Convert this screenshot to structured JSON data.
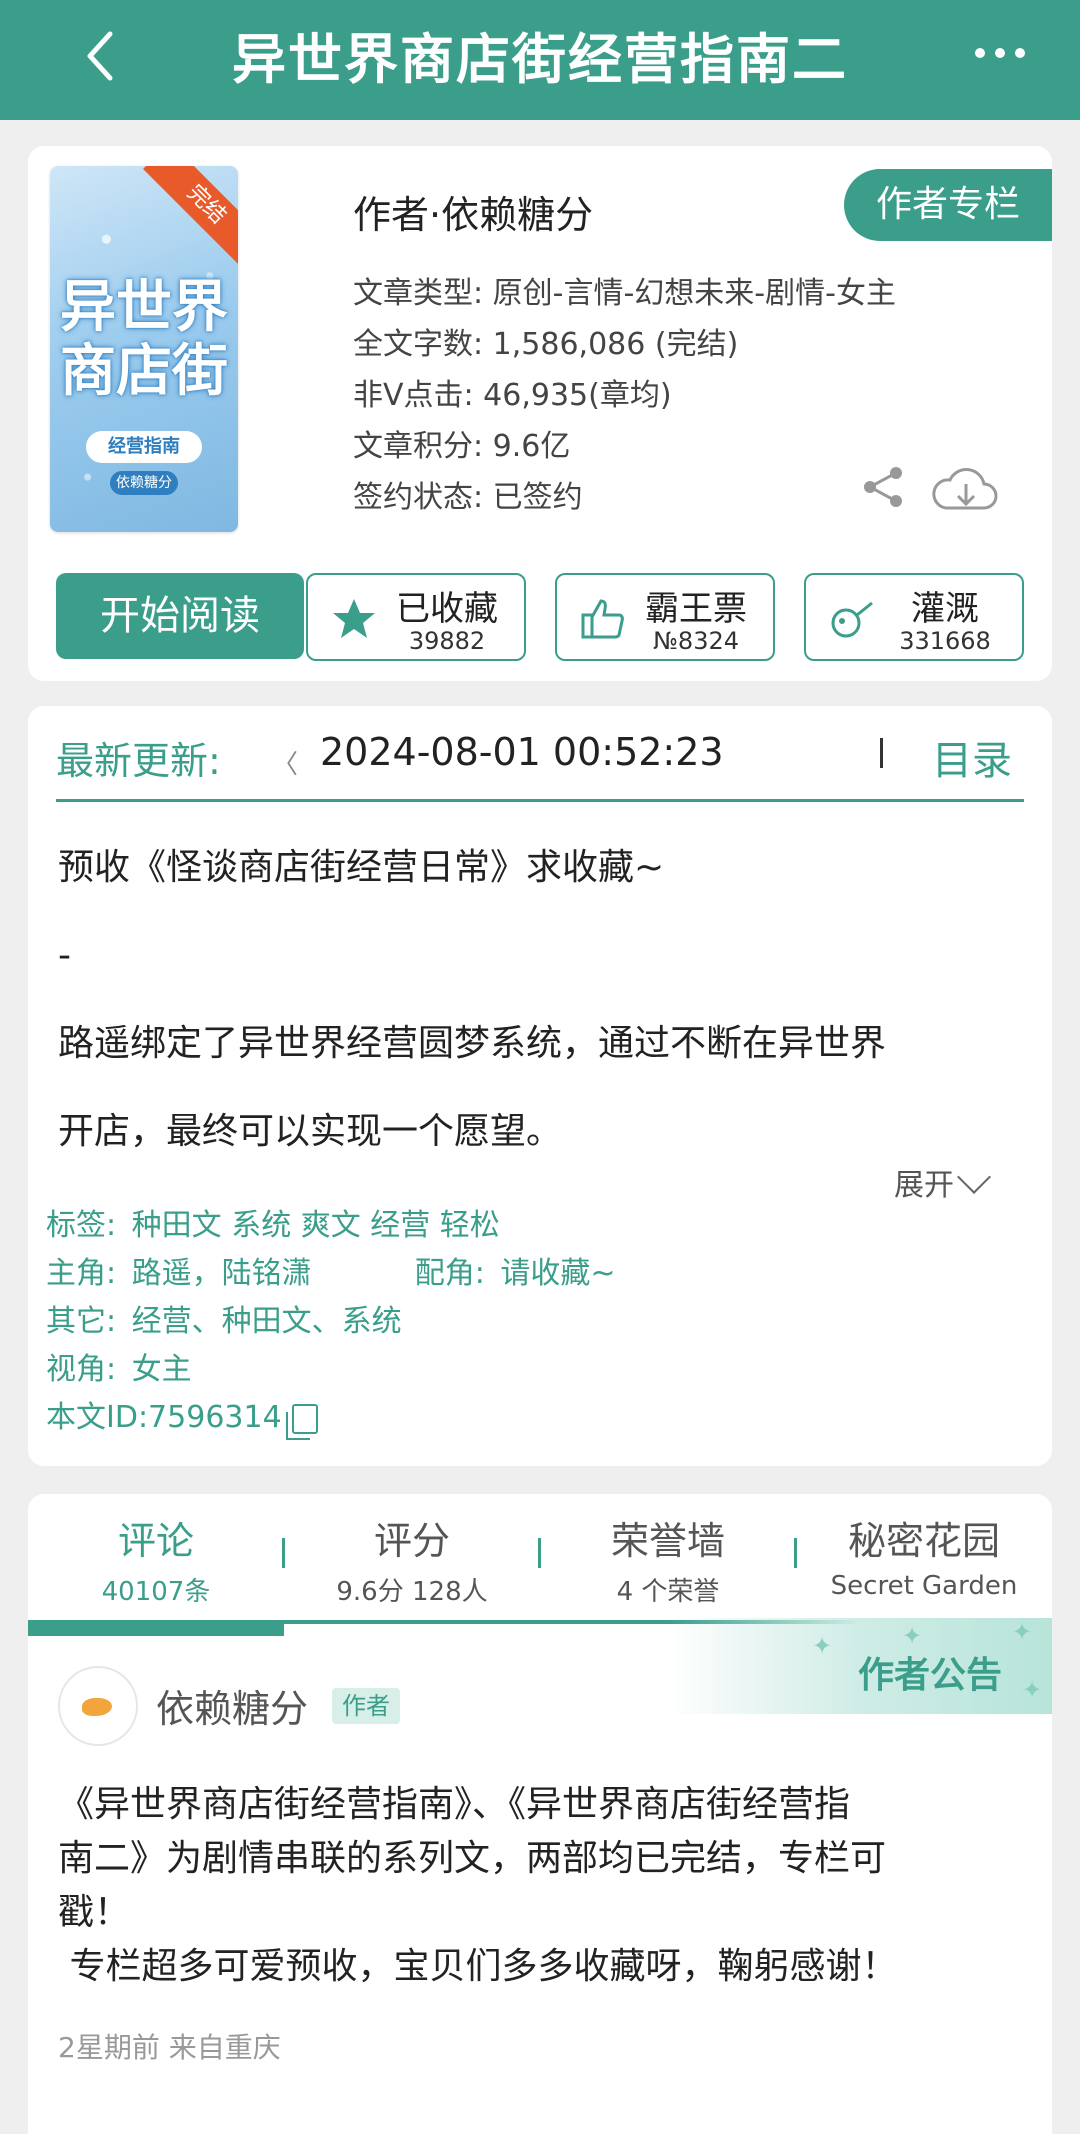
{
  "header": {
    "title": "异世界商店街经营指南二",
    "back_icon": "back-arrow-icon",
    "more_icon": "more-dots-icon"
  },
  "book": {
    "cover_title": "异世界商店街",
    "cover_subtitle": "经营指南",
    "cover_author": "依赖糖分",
    "ribbon": "完结",
    "author_line": "作者·依赖糖分",
    "author_column_button": "作者专栏",
    "meta": [
      "文章类型: 原创-言情-幻想未来-剧情-女主",
      "全文字数: 1,586,086 (完结)",
      "非Ⅴ点击: 46,935(章均)",
      "文章积分: 9.6亿",
      "签约状态: 已签约"
    ]
  },
  "actions": {
    "read_button": "开始阅读",
    "favorite": {
      "label": "已收藏",
      "count": "39882"
    },
    "ticket": {
      "label": "霸王票",
      "count": "№8324"
    },
    "irrigate": {
      "label": "灌溉",
      "count": "331668"
    }
  },
  "update": {
    "label": "最新更新:",
    "spinner": "〈",
    "time": "2024-08-01 00:52:23",
    "toc": "目录"
  },
  "intro": {
    "lines": [
      "预收《怪谈商店街经营日常》求收藏~",
      "-",
      "路遥绑定了异世界经营圆梦系统，通过不断在异世界",
      "开店，最终可以实现一个愿望。"
    ],
    "expand": "展开"
  },
  "tags": {
    "tags_label": "标签:",
    "tags_value": "种田文 系统 爽文 经营 轻松",
    "main_label": "主角:",
    "main_value": "路遥，陆铭潇",
    "support_label": "配角:",
    "support_value": "请收藏~",
    "other_label": "其它:",
    "other_value": "经营、种田文、系统",
    "view_label": "视角:",
    "view_value": "女主",
    "id_text": "本文ID:7596314"
  },
  "tabs": [
    {
      "title": "评论",
      "sub": "40107条"
    },
    {
      "title": "评分",
      "sub": "9.6分 128人"
    },
    {
      "title": "荣誉墙",
      "sub": "4 个荣誉"
    },
    {
      "title": "秘密花园",
      "sub": "Secret Garden"
    }
  ],
  "notice": {
    "label": "作者公告",
    "poster": "依赖糖分",
    "badge": "作者",
    "lines": [
      "《异世界商店街经营指南》、《异世界商店街经营指",
      "南二》为剧情串联的系列文，两部均已完结，专栏可",
      "戳！",
      " 专栏超多可爱预收，宝贝们多多收藏呀，鞠躬感谢！"
    ],
    "meta": "2星期前 来自重庆"
  },
  "colors": {
    "accent": "#3a9e8b",
    "ribbon": "#e85a2a",
    "background": "#efefef"
  }
}
